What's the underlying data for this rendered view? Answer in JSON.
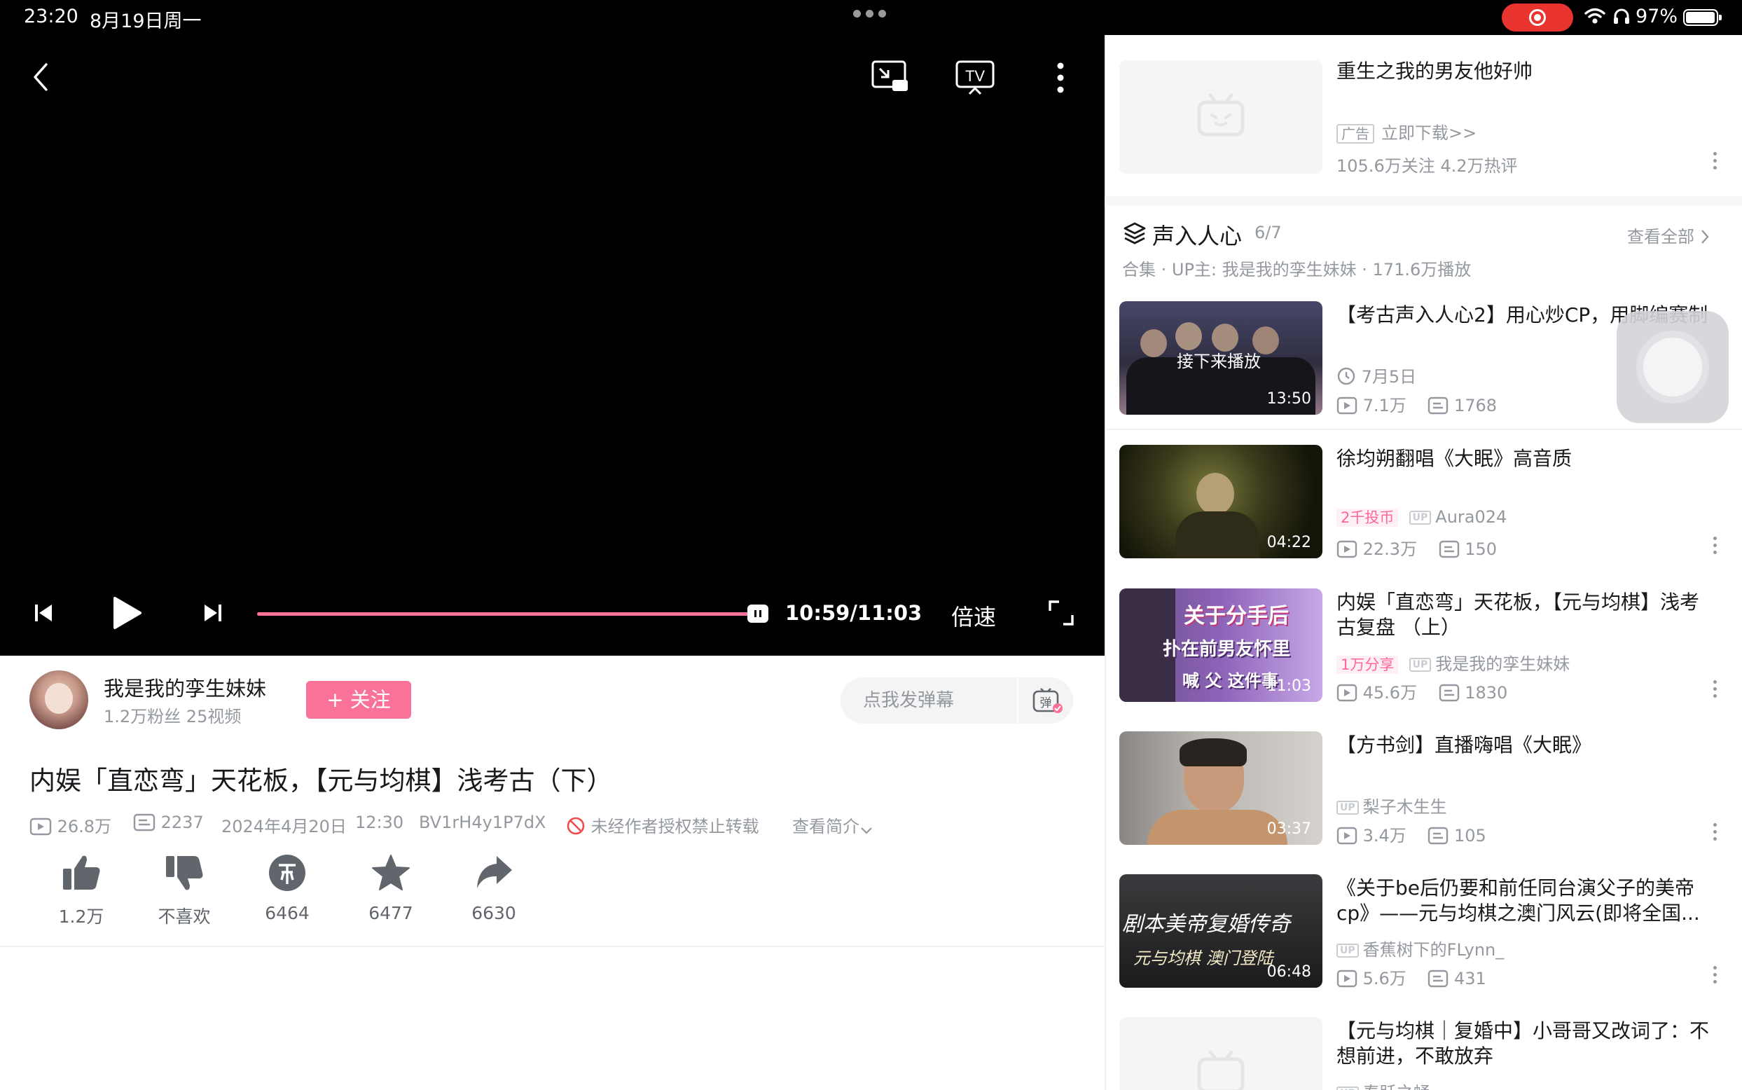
{
  "status_bar": {
    "time": "23:20",
    "date": "8月19日周一",
    "battery": "97%"
  },
  "player": {
    "timecode": "10:59/11:03",
    "speed_label": "倍速",
    "progress": 0.984
  },
  "uploader": {
    "name": "我是我的孪生妹妹",
    "stats": "1.2万粉丝  25视频",
    "follow_label": "+ 关注"
  },
  "danmaku": {
    "placeholder": "点我发弹幕",
    "button_glyph": "弹"
  },
  "video": {
    "title": "内娱「直恋弯」天花板，【元与均棋】浅考古（下）",
    "views": "26.8万",
    "danmaku_count": "2237",
    "date": "2024年4月20日",
    "time": "12:30",
    "bvid": "BV1rH4y1P7dX",
    "copyright": "未经作者授权禁止转载",
    "intro_link": "查看简介"
  },
  "actions": {
    "like": "1.2万",
    "dislike": "不喜欢",
    "coin": "6464",
    "favorite": "6477",
    "share": "6630"
  },
  "ad": {
    "title": "重生之我的男友他好帅",
    "tag": "广告",
    "cta": "立即下载>>",
    "stats": "105.6万关注    4.2万热评"
  },
  "collection": {
    "title": "声入人心",
    "count": "6/7",
    "view_all": "查看全部",
    "subtitle": "合集 · UP主: 我是我的孪生妹妹 · 171.6万播放"
  },
  "items": [
    {
      "title": "【考古声入人心2】用心炒CP，用脚编赛制",
      "date": "7月5日",
      "views": "7.1万",
      "danmaku": "1768",
      "duration": "13:50",
      "overlay": "接下来播放"
    },
    {
      "title": "徐均朔翻唱《大眠》高音质",
      "badge": "2千投币",
      "author": "Aura024",
      "views": "22.3万",
      "danmaku": "150",
      "duration": "04:22"
    },
    {
      "title": "内娱「直恋弯」天花板，【元与均棋】浅考古复盘 （上）",
      "badge": "1万分享",
      "author": "我是我的孪生妹妹",
      "views": "45.6万",
      "danmaku": "1830",
      "duration": "11:03",
      "thumb_text_1": "关于分手后",
      "thumb_text_2": "扑在前男友怀里",
      "thumb_text_3": "喊 父 这件事"
    },
    {
      "title": "【方书剑】直播嗨唱《大眠》",
      "author": "梨子木生生",
      "views": "3.4万",
      "danmaku": "105",
      "duration": "03:37"
    },
    {
      "title": "《关于be后仍要和前任同台演父子的美帝cp》——元与均棋之澳门风云(即将全国...",
      "author": "香蕉树下的FLynn_",
      "views": "5.6万",
      "danmaku": "431",
      "duration": "06:48",
      "thumb_text_1": "剧本美帝复婚传奇",
      "thumb_text_2": "元与均棋 澳门登陆"
    },
    {
      "title": "【元与均棋｜复婚中】小哥哥又改词了：不想前进，不敢放弃",
      "author": "春跃之蛹"
    }
  ],
  "up_marker": "UP",
  "colors": {
    "accent": "#fb7299",
    "muted": "#9499a0",
    "text": "#18191c"
  }
}
